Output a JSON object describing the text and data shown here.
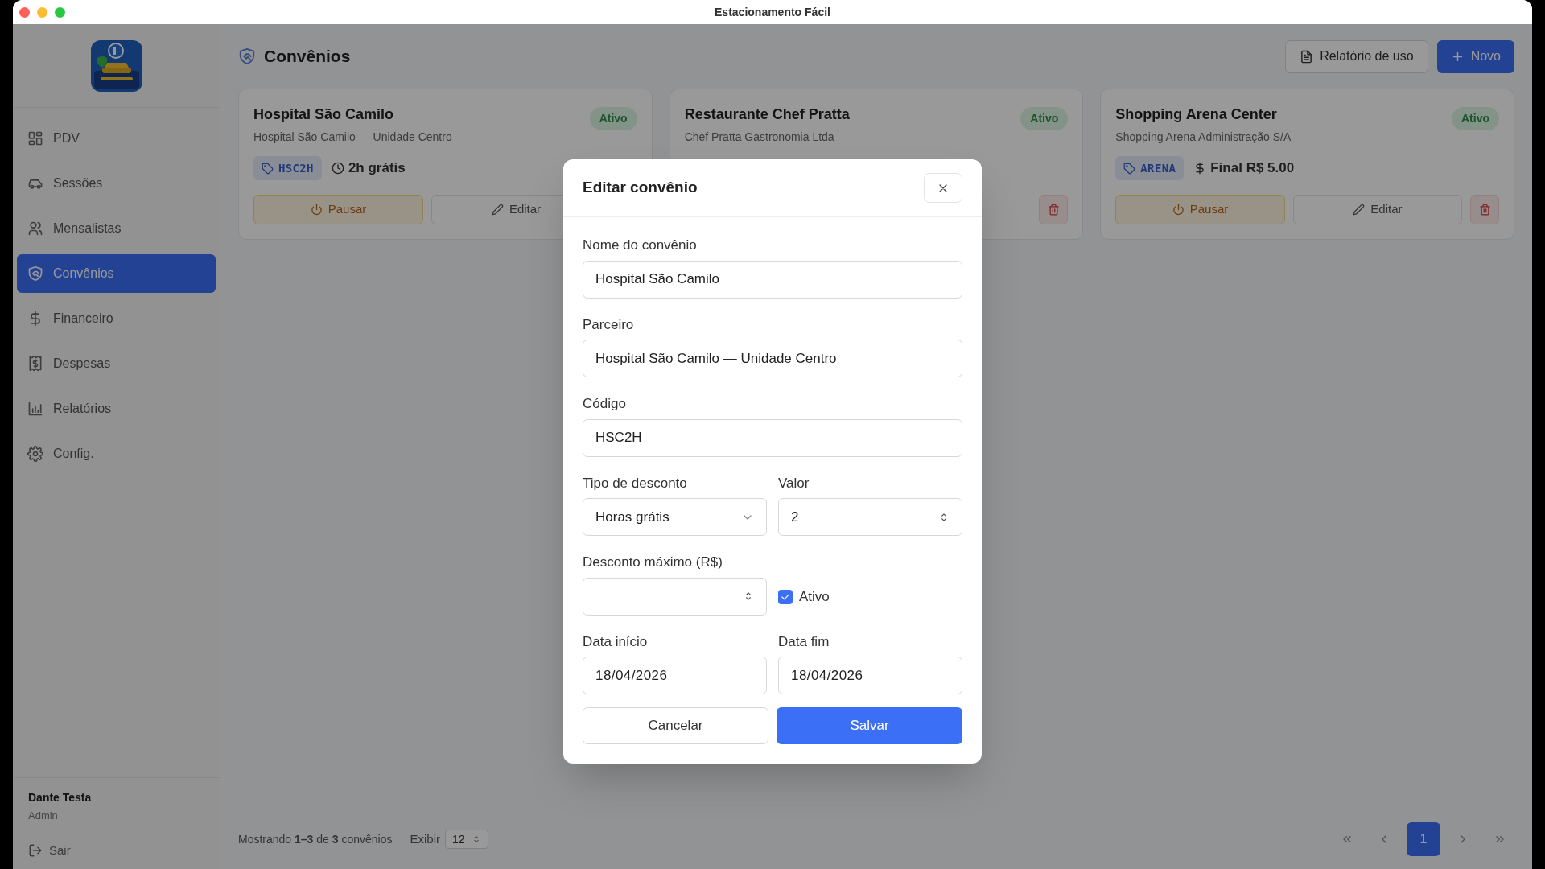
{
  "window": {
    "title": "Estacionamento Fácil"
  },
  "sidebar": {
    "items": [
      {
        "label": "PDV",
        "selected": false
      },
      {
        "label": "Sessões",
        "selected": false
      },
      {
        "label": "Mensalistas",
        "selected": false
      },
      {
        "label": "Convênios",
        "selected": true
      },
      {
        "label": "Financeiro",
        "selected": false
      },
      {
        "label": "Despesas",
        "selected": false
      },
      {
        "label": "Relatórios",
        "selected": false
      },
      {
        "label": "Config.",
        "selected": false
      }
    ],
    "user": {
      "name": "Dante Testa",
      "role": "Admin"
    },
    "logout": "Sair"
  },
  "header": {
    "title": "Convênios",
    "actions": [
      {
        "label": "Relatório de uso",
        "kind": "secondary"
      },
      {
        "label": "Novo",
        "kind": "primary"
      }
    ]
  },
  "cards": [
    {
      "name": "Hospital São Camilo",
      "partner": "Hospital São Camilo — Unidade Centro",
      "status": "Ativo",
      "code": "HSC2H",
      "discount": {
        "kind": "hours",
        "text": "2h grátis"
      },
      "actions": [
        {
          "kind": "pause",
          "label": "Pausar"
        },
        {
          "kind": "edit",
          "label": "Editar"
        }
      ]
    },
    {
      "name": "Restaurante Chef Pratta",
      "partner": "Chef Pratta Gastronomia Ltda",
      "status": "Ativo",
      "actions": [
        {
          "kind": "delete"
        }
      ]
    },
    {
      "name": "Shopping Arena Center",
      "partner": "Shopping Arena Administração S/A",
      "status": "Ativo",
      "code": "ARENA",
      "discount": {
        "kind": "price",
        "text": "Final R$ 5.00"
      },
      "actions": [
        {
          "kind": "pause",
          "label": "Pausar"
        },
        {
          "kind": "edit",
          "label": "Editar"
        },
        {
          "kind": "delete"
        }
      ]
    }
  ],
  "footer": {
    "summary": "Mostrando **1–3** de **3** convênios",
    "page_size_label": "Exibir",
    "page_size": "12",
    "pages": [
      {
        "label": "1",
        "selected": true
      }
    ]
  },
  "modal": {
    "title": "Editar convênio",
    "rows": [
      [
        {
          "kind": "text",
          "label": "Nome do convênio",
          "value": "Hospital São Camilo"
        }
      ],
      [
        {
          "kind": "text",
          "label": "Parceiro",
          "value": "Hospital São Camilo — Unidade Centro"
        }
      ],
      [
        {
          "kind": "text",
          "label": "Código",
          "value": "HSC2H"
        }
      ],
      [
        {
          "kind": "select",
          "label": "Tipo de desconto",
          "value": "Horas grátis"
        },
        {
          "kind": "number",
          "label": "Valor",
          "value": "2"
        }
      ],
      [
        {
          "kind": "number",
          "label": "Desconto máximo (R$)"
        },
        {
          "kind": "checkbox",
          "label": "Ativo",
          "checked": true
        }
      ],
      [
        {
          "kind": "date",
          "label": "Data início",
          "value": "18/04/2026"
        },
        {
          "kind": "date",
          "label": "Data fim",
          "value": "18/04/2026"
        }
      ]
    ],
    "buttons": [
      {
        "label": "Cancelar",
        "kind": "secondary"
      },
      {
        "label": "Salvar",
        "kind": "primary"
      }
    ]
  }
}
